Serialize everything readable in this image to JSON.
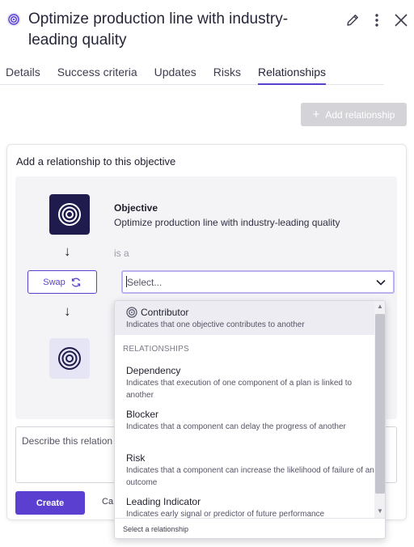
{
  "header": {
    "title": "Optimize production line with industry-leading quality",
    "icons": [
      "objective-icon",
      "edit-icon",
      "more-icon",
      "close-icon"
    ]
  },
  "tabs": [
    {
      "label": "Details"
    },
    {
      "label": "Success criteria"
    },
    {
      "label": "Updates"
    },
    {
      "label": "Risks"
    },
    {
      "label": "Relationships",
      "active": true
    }
  ],
  "add_relationship": {
    "label": "Add relationship",
    "disabled": true
  },
  "panel": {
    "title": "Add a relationship to this objective",
    "source": {
      "type_label": "Objective",
      "name": "Optimize production line with industry-leading quality"
    },
    "is_a_label": "is a",
    "swap_label": "Swap",
    "select": {
      "placeholder": "Select...",
      "value": ""
    },
    "description_placeholder": "Describe this relation",
    "create_label": "Create",
    "cancel_label": "Ca"
  },
  "dropdown": {
    "highlighted": {
      "name": "Contributor",
      "description": "Indicates that one objective contributes to another"
    },
    "section_label": "RELATIONSHIPS",
    "items": [
      {
        "name": "Dependency",
        "description": "Indicates that execution of one component of a plan is linked to another"
      },
      {
        "name": "Blocker",
        "description": "Indicates that a component can delay the progress of another"
      },
      {
        "name": "Risk",
        "description": "Indicates that a component can increase the likelihood of failure of an outcome"
      },
      {
        "name": "Leading Indicator",
        "description": "Indicates early signal or predictor of future performance"
      }
    ],
    "footer": "Select a relationship"
  },
  "colors": {
    "accent": "#5b3fd1",
    "objective_tile": "#1f1c4d",
    "disabled_button": "#d4d4d8"
  }
}
